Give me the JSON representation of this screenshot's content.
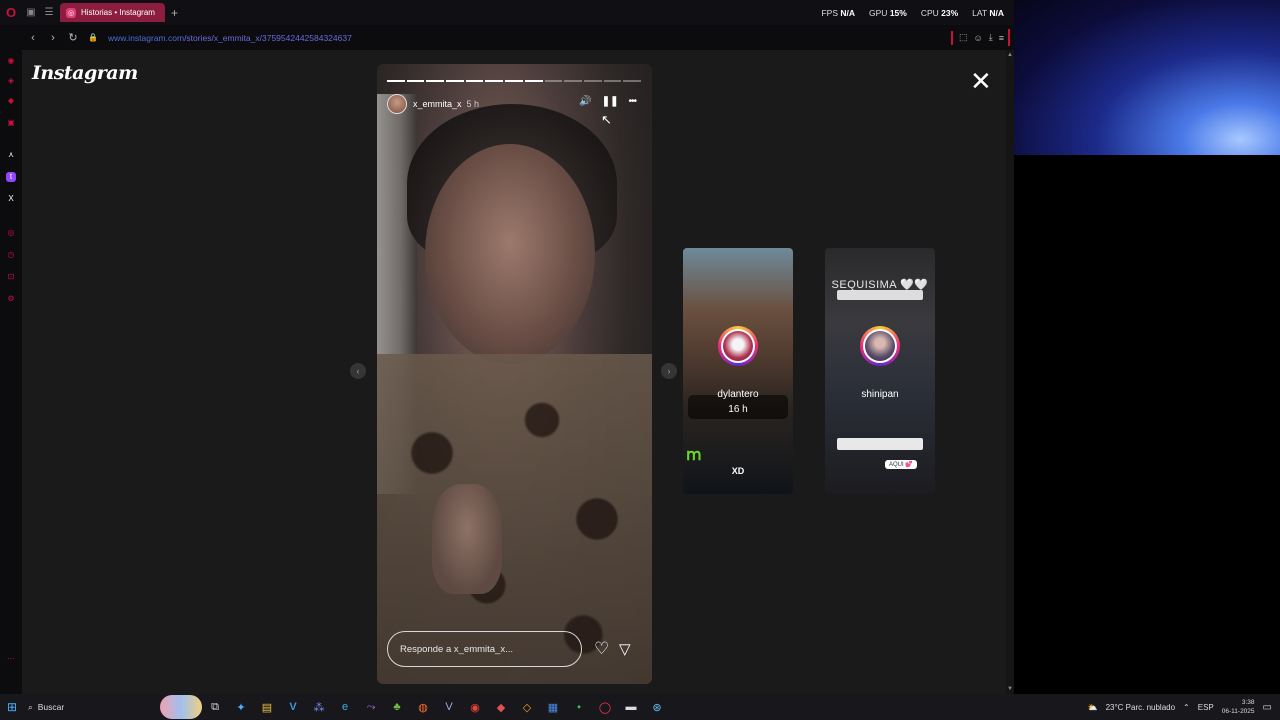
{
  "browser": {
    "tab_title": "Historias • Instagram",
    "new_tab": "+",
    "url_host": "www.instagram.com",
    "url_path": "/stories/x_emmita_x/3759542442584324637",
    "stats": [
      {
        "label": "FPS",
        "value": "N/A"
      },
      {
        "label": "GPU",
        "value": "15%"
      },
      {
        "label": "CPU",
        "value": "23%"
      },
      {
        "label": "LAT",
        "value": "N/A"
      }
    ]
  },
  "instagram": {
    "logo": "Instagram",
    "close": "✕"
  },
  "story": {
    "username": "x_emmita_x",
    "time": "5 h",
    "progress_total": 13,
    "progress_done": 8,
    "reply_placeholder": "Responde a x_emmita_x...",
    "controls": {
      "mute": "🔊",
      "pause": "❚❚",
      "more": "•••"
    }
  },
  "previews": [
    {
      "username": "dylantero",
      "time": "16 h",
      "caption": "XD"
    },
    {
      "username": "shinipan",
      "time": "",
      "header": "SEQUISIMA 🤍🤍",
      "cta": "AQUI 💕"
    }
  ],
  "taskbar": {
    "search_label": "Buscar",
    "weather": "23°C  Parc. nublado",
    "lang": "ESP",
    "time": "3:38",
    "date": "06-11-2025"
  }
}
